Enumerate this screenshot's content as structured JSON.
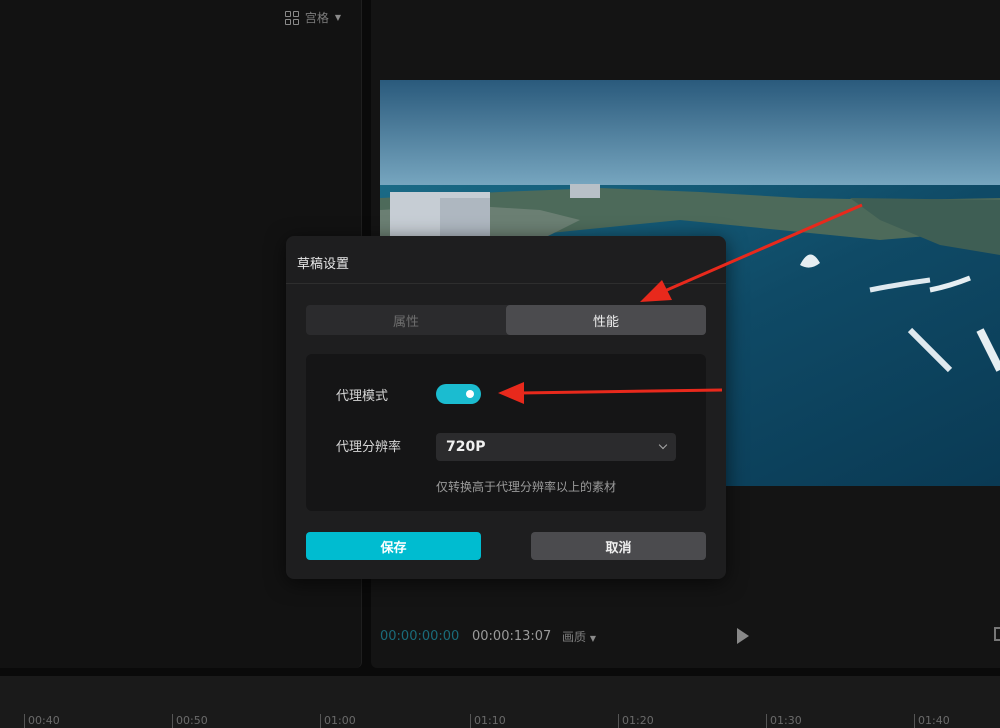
{
  "media_panel": {
    "view_mode_label": "宫格"
  },
  "player": {
    "current_time": "00:00:00:00",
    "total_time": "00:00:13:07",
    "quality_label": "画质"
  },
  "timeline": {
    "ticks": [
      "00:40",
      "00:50",
      "01:00",
      "01:10",
      "01:20",
      "01:30",
      "01:40"
    ]
  },
  "dialog": {
    "title": "草稿设置",
    "tabs": [
      {
        "label": "属性",
        "active": false
      },
      {
        "label": "性能",
        "active": true
      }
    ],
    "proxy_mode": {
      "label": "代理模式",
      "enabled": true
    },
    "proxy_resolution": {
      "label": "代理分辨率",
      "value": "720P"
    },
    "hint": "仅转换高于代理分辨率以上的素材",
    "save_label": "保存",
    "cancel_label": "取消"
  },
  "colors": {
    "accent": "#00bcd0",
    "annotation_arrow": "#e8291c"
  }
}
